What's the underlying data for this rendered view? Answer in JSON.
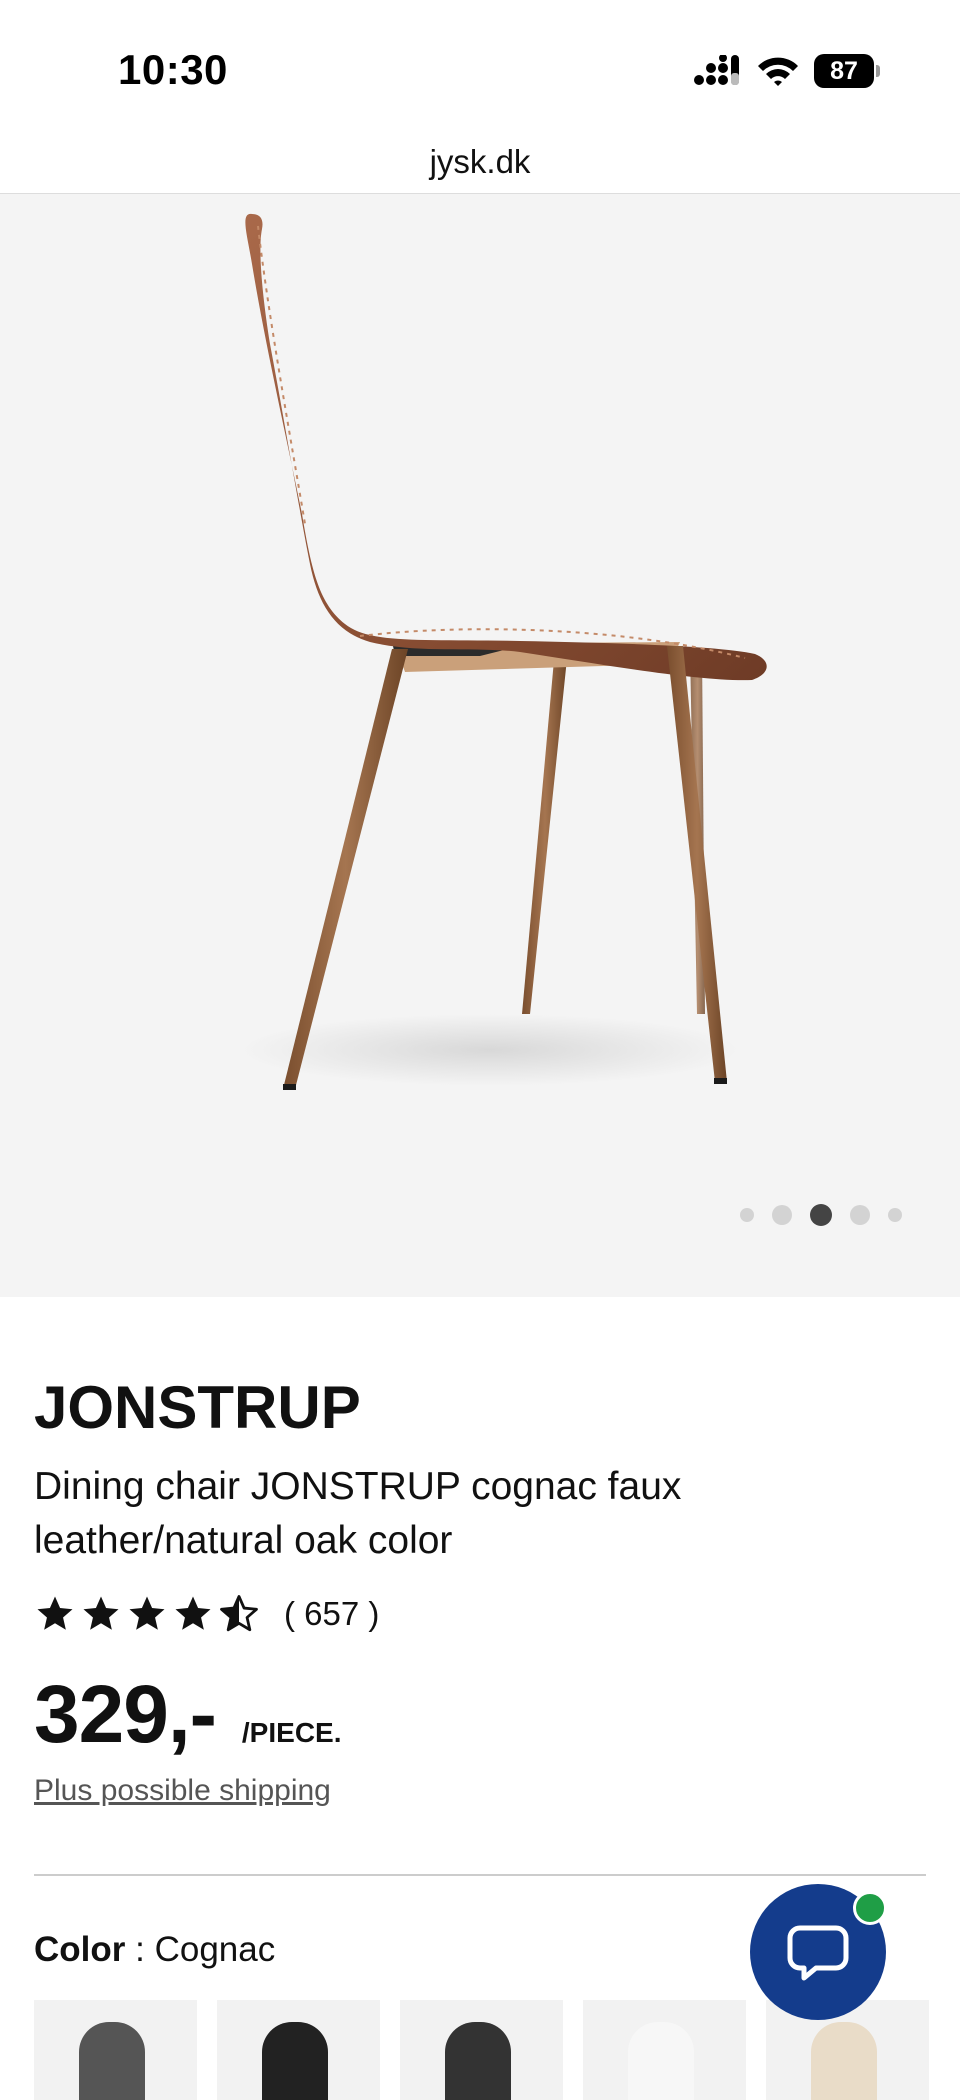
{
  "status_bar": {
    "time": "10:30",
    "battery_level": "87",
    "icons": [
      "signal-icon",
      "wifi-icon",
      "battery-icon"
    ]
  },
  "browser": {
    "url": "jysk.dk"
  },
  "gallery": {
    "image_count": 5,
    "active_index": 2
  },
  "product": {
    "brand": "JONSTRUP",
    "name": "Dining chair JONSTRUP cognac faux leather/natural oak color",
    "rating_value": 4.5,
    "rating_max": 5,
    "review_count": "( 657 )",
    "price": "329,-",
    "price_unit": "/PIECE.",
    "shipping_link": "Plus possible shipping"
  },
  "color_selector": {
    "label": "Color",
    "separator": " : ",
    "selected": "Cognac",
    "swatch_colors": [
      "#555555",
      "#222222",
      "#333333",
      "#f7f7f7",
      "#e9dcc8"
    ]
  },
  "colors": {
    "chat_button": "#143c8c",
    "chat_badge": "#1f9e46",
    "gallery_background": "#f4f4f4"
  }
}
